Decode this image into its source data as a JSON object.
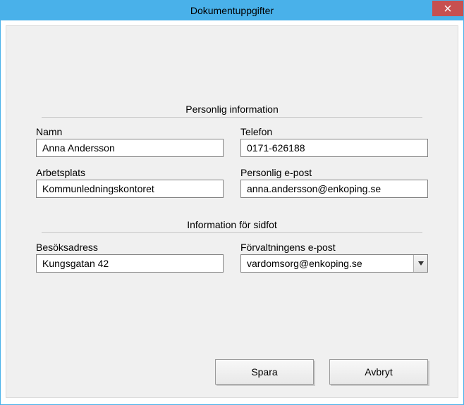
{
  "window": {
    "title": "Dokumentuppgifter"
  },
  "section1": {
    "header": "Personlig information",
    "name_label": "Namn",
    "name_value": "Anna Andersson",
    "phone_label": "Telefon",
    "phone_value": "0171-626188",
    "workplace_label": "Arbetsplats",
    "workplace_value": "Kommunledningskontoret",
    "email_label": "Personlig e-post",
    "email_value": "anna.andersson@enkoping.se"
  },
  "section2": {
    "header": "Information för sidfot",
    "address_label": "Besöksadress",
    "address_value": "Kungsgatan 42",
    "org_email_label": "Förvaltningens e-post",
    "org_email_value": "vardomsorg@enkoping.se"
  },
  "buttons": {
    "save": "Spara",
    "cancel": "Avbryt"
  }
}
